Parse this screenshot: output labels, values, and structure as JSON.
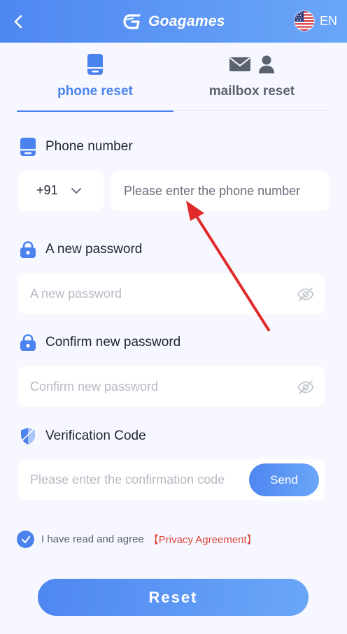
{
  "header": {
    "brand": "Goagames",
    "language": "EN",
    "icons": {
      "back": "chevron-left-icon",
      "logo": "goagames-logo-icon",
      "flag": "us-flag-icon"
    }
  },
  "tabs": [
    {
      "label": "phone reset",
      "active": true,
      "icon": "phone-icon"
    },
    {
      "label": "mailbox reset",
      "active": false,
      "icon": "mail-user-icon"
    }
  ],
  "phone": {
    "label": "Phone number",
    "country_code": "+91",
    "placeholder": "Please enter the phone number",
    "value": ""
  },
  "new_password": {
    "label": "A new password",
    "placeholder": "A new password"
  },
  "confirm_password": {
    "label": "Confirm new password",
    "placeholder": "Confirm new password"
  },
  "verification": {
    "label": "Verification Code",
    "placeholder": "Please enter the confirmation code",
    "send_label": "Send"
  },
  "agreement": {
    "text": "I have read and agree",
    "link": "【Privacy Agreement】",
    "checked": true
  },
  "reset_label": "Reset",
  "colors": {
    "primary": "#4a82ee",
    "link": "#e0453b",
    "background": "#f7f8ff",
    "annotation_arrow": "#e02b2b"
  }
}
